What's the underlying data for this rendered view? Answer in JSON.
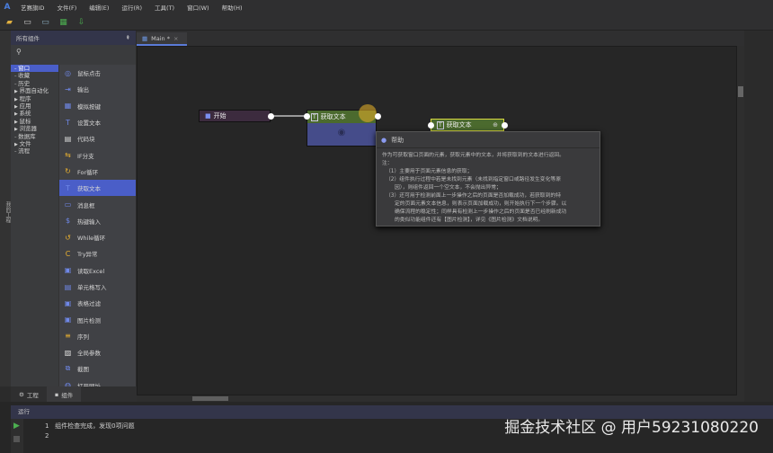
{
  "app": {
    "menu": [
      "艺赛旗ID",
      "文件(F)",
      "编辑(E)",
      "运行(R)",
      "工具(T)",
      "窗口(W)",
      "帮助(H)"
    ]
  },
  "toolbar": {
    "icons": [
      "open-folder-icon",
      "save-icon",
      "save-as-icon",
      "run-icon",
      "deploy-icon"
    ]
  },
  "left_strip": {
    "label": "我的工程"
  },
  "panel": {
    "title": "所有组件",
    "tree": [
      {
        "label": "窗口",
        "selected": true
      },
      {
        "label": "收藏"
      },
      {
        "label": "历史"
      },
      {
        "label": "界面自动化",
        "arrow": true
      },
      {
        "label": "程序",
        "arrow": true
      },
      {
        "label": "应用",
        "arrow": true
      },
      {
        "label": "系统",
        "arrow": true
      },
      {
        "label": "鼠标",
        "arrow": true
      },
      {
        "label": "浏览器",
        "arrow": true
      },
      {
        "label": "数据库"
      },
      {
        "label": "文件",
        "arrow": true
      },
      {
        "label": "流程"
      }
    ],
    "components": [
      {
        "label": "鼠标点击",
        "icon": "◎",
        "color": "#6f88e8"
      },
      {
        "label": "输出",
        "icon": "⇥",
        "color": "#6f88e8"
      },
      {
        "label": "模拟按键",
        "icon": "▦",
        "color": "#6f88e8"
      },
      {
        "label": "设置文本",
        "icon": "T",
        "color": "#6f88e8"
      },
      {
        "label": "代码块",
        "icon": "▤",
        "color": "#dddddd"
      },
      {
        "label": "IF分支",
        "icon": "⇆",
        "color": "#e8b030"
      },
      {
        "label": "For循环",
        "icon": "↻",
        "color": "#e8b030"
      },
      {
        "label": "获取文本",
        "icon": "T",
        "color": "#6f88e8",
        "selected": true
      },
      {
        "label": "消息框",
        "icon": "▭",
        "color": "#6f88e8"
      },
      {
        "label": "热键输入",
        "icon": "$",
        "color": "#6f88e8"
      },
      {
        "label": "While循环",
        "icon": "↺",
        "color": "#e8b030"
      },
      {
        "label": "Try异常",
        "icon": "C",
        "color": "#e8b030"
      },
      {
        "label": "读取Excel",
        "icon": "▣",
        "color": "#6f88e8"
      },
      {
        "label": "单元格写入",
        "icon": "▤",
        "color": "#6f88e8"
      },
      {
        "label": "表格过滤",
        "icon": "▣",
        "color": "#6f88e8"
      },
      {
        "label": "图片检测",
        "icon": "▣",
        "color": "#6f88e8"
      },
      {
        "label": "序列",
        "icon": "≡",
        "color": "#e8b030"
      },
      {
        "label": "全局参数",
        "icon": "▨",
        "color": "#dddddd"
      },
      {
        "label": "截图",
        "icon": "⧉",
        "color": "#6f88e8"
      },
      {
        "label": "打开网址",
        "icon": "◍",
        "color": "#6f88e8"
      }
    ]
  },
  "editor": {
    "tab": "Main *",
    "close": "×"
  },
  "nodes": {
    "start": "开始",
    "get_text_1": "获取文本",
    "get_text_2": "获取文本"
  },
  "help": {
    "title": "帮助",
    "lines": [
      "作为可获取窗口页面的元素，获取元素中的文本，并将获取到的文本进行返回。",
      "注：",
      "（1）主要用于页面元素信息的获取；",
      "（2）组件执行过程中若是未找到元素（未找到指定窗口或路径发生变化等原",
      "因），则组件返回一个空文本，不会抛出异常；",
      "（3）还可用于检测前面上一步操作之后的页面是否加载成功，若获取到的特",
      "定的页面元素文本信息，则表示页面加载成功，则开始执行下一个步骤。以",
      "确保流程的稳定性；同样具有检测上一步操作之后的页面是否已经刷新成功",
      "的类似功能组件还有【图片检测】，详见《图片检测》文档说明。"
    ]
  },
  "bottom_tabs": [
    "工程",
    "组件"
  ],
  "run": {
    "title": "运行",
    "lines": [
      {
        "n": "1",
        "text": "组件检查完成，发现0项问题"
      },
      {
        "n": "2",
        "text": ""
      }
    ]
  },
  "watermark": "掘金技术社区 @ 用户59231080220"
}
